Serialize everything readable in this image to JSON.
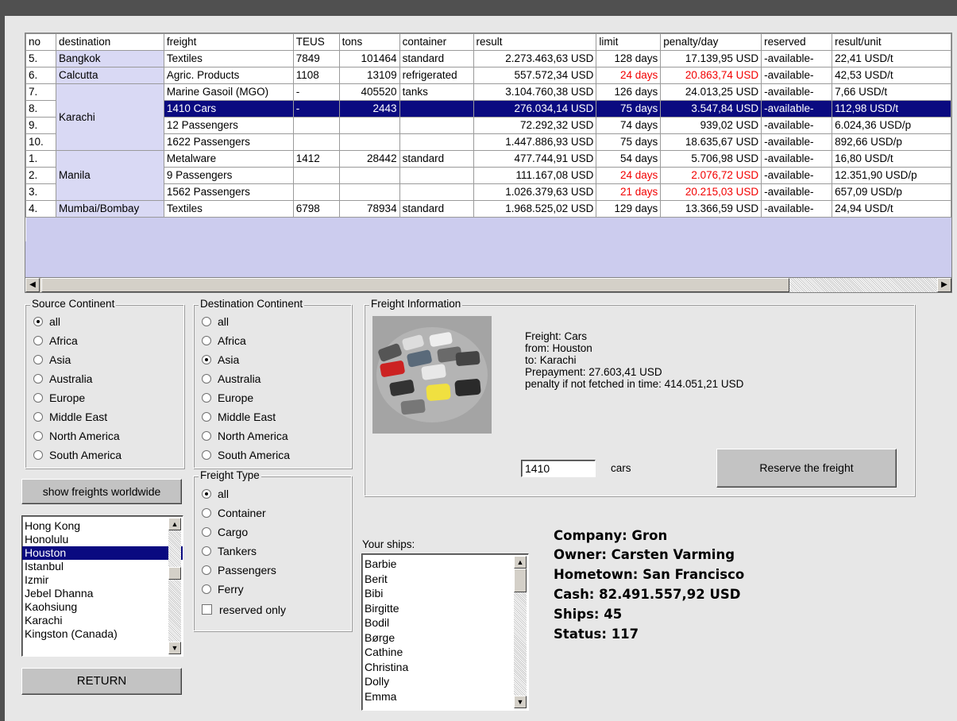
{
  "grid": {
    "columns": [
      "no",
      "destination",
      "freight",
      "TEUS",
      "tons",
      "container",
      "result",
      "limit",
      "penalty/day",
      "reserved",
      "result/unit"
    ],
    "rows": [
      {
        "no": "5.",
        "destination": "Bangkok",
        "freight": "Textiles",
        "teus": "7849",
        "tons": "101464",
        "container": "standard",
        "result": "2.273.463,63 USD",
        "limit": "128 days",
        "penalty": "17.139,95 USD",
        "reserved": "-available-",
        "unit": "22,41 USD/t"
      },
      {
        "no": "6.",
        "destination": "Calcutta",
        "freight": "Agric. Products",
        "teus": "1108",
        "tons": "13109",
        "container": "refrigerated",
        "result": "557.572,34 USD",
        "limit": "24 days",
        "penalty": "20.863,74 USD",
        "reserved": "-available-",
        "unit": "42,53 USD/t"
      },
      {
        "no": "7.",
        "destination": "Karachi",
        "freight": "Marine Gasoil (MGO)",
        "teus": "-",
        "tons": "405520",
        "container": "tanks",
        "result": "3.104.760,38 USD",
        "limit": "126 days",
        "penalty": "24.013,25 USD",
        "reserved": "-available-",
        "unit": "7,66 USD/t"
      },
      {
        "no": "8.",
        "destination": "",
        "freight": "1410 Cars",
        "teus": "-",
        "tons": "2443",
        "container": "",
        "result": "276.034,14 USD",
        "limit": "75 days",
        "penalty": "3.547,84 USD",
        "reserved": "-available-",
        "unit": "112,98 USD/t"
      },
      {
        "no": "9.",
        "destination": "",
        "freight": "12 Passengers",
        "teus": "",
        "tons": "",
        "container": "",
        "result": "72.292,32 USD",
        "limit": "74 days",
        "penalty": "939,02 USD",
        "reserved": "-available-",
        "unit": "6.024,36 USD/p"
      },
      {
        "no": "10.",
        "destination": "",
        "freight": "1622 Passengers",
        "teus": "",
        "tons": "",
        "container": "",
        "result": "1.447.886,93 USD",
        "limit": "75 days",
        "penalty": "18.635,67 USD",
        "reserved": "-available-",
        "unit": "892,66 USD/p"
      },
      {
        "no": "1.",
        "destination": "Manila",
        "freight": "Metalware",
        "teus": "1412",
        "tons": "28442",
        "container": "standard",
        "result": "477.744,91 USD",
        "limit": "54 days",
        "penalty": "5.706,98 USD",
        "reserved": "-available-",
        "unit": "16,80 USD/t"
      },
      {
        "no": "2.",
        "destination": "",
        "freight": "9 Passengers",
        "teus": "",
        "tons": "",
        "container": "",
        "result": "111.167,08 USD",
        "limit": "24 days",
        "penalty": "2.076,72 USD",
        "reserved": "-available-",
        "unit": "12.351,90 USD/p"
      },
      {
        "no": "3.",
        "destination": "",
        "freight": "1562 Passengers",
        "teus": "",
        "tons": "",
        "container": "",
        "result": "1.026.379,63 USD",
        "limit": "21 days",
        "penalty": "20.215,03 USD",
        "reserved": "-available-",
        "unit": "657,09 USD/p"
      },
      {
        "no": "4.",
        "destination": "Mumbai/Bombay",
        "freight": "Textiles",
        "teus": "6798",
        "tons": "78934",
        "container": "standard",
        "result": "1.968.525,02 USD",
        "limit": "129 days",
        "penalty": "13.366,59 USD",
        "reserved": "-available-",
        "unit": "24,94 USD/t"
      }
    ],
    "selected_row": "8.",
    "red_rows": [
      "6.",
      "2.",
      "3."
    ],
    "colors": {
      "selection": "#0a0a80",
      "destination_bg": "#d9d9f4",
      "warning_text": "#f20000"
    }
  },
  "source_continent": {
    "title": "Source Continent",
    "options": [
      "all",
      "Africa",
      "Asia",
      "Australia",
      "Europe",
      "Middle East",
      "North America",
      "South America"
    ],
    "selected": "all"
  },
  "destination_continent": {
    "title": "Destination Continent",
    "options": [
      "all",
      "Africa",
      "Asia",
      "Australia",
      "Europe",
      "Middle East",
      "North America",
      "South America"
    ],
    "selected": "Asia"
  },
  "freight_type": {
    "title": "Freight Type",
    "options": [
      "all",
      "Container",
      "Cargo",
      "Tankers",
      "Passengers",
      "Ferry"
    ],
    "selected": "all",
    "reserved_only_label": "reserved only",
    "reserved_only_checked": false
  },
  "freight_info": {
    "title": "Freight Information",
    "freight": "Freight: Cars",
    "from": "from: Houston",
    "to": "to: Karachi",
    "prepayment": "Prepayment: 27.603,41 USD",
    "penalty": "penalty if not fetched in time: 414.051,21 USD",
    "quantity_value": "1410",
    "quantity_unit": "cars",
    "reserve_button": "Reserve the freight",
    "image_icon": "cars-photo"
  },
  "buttons": {
    "show_worldwide": "show freights worldwide",
    "return": "RETURN"
  },
  "ports": {
    "items": [
      "Hong Kong",
      "Honolulu",
      "Houston",
      "Istanbul",
      "Izmir",
      "Jebel Dhanna",
      "Kaohsiung",
      "Karachi",
      "Kingston (Canada)"
    ],
    "selected": "Houston"
  },
  "ships": {
    "label": "Your ships:",
    "items": [
      "Barbie",
      "Berit",
      "Bibi",
      "Birgitte",
      "Bodil",
      "Børge",
      "Cathine",
      "Christina",
      "Dolly",
      "Emma"
    ]
  },
  "company": {
    "name": "Company: Gron",
    "owner": "Owner: Carsten Varming",
    "hometown": "Hometown: San Francisco",
    "cash": "Cash: 82.491.557,92 USD",
    "ships": "Ships:  45",
    "status": "Status:  117"
  }
}
